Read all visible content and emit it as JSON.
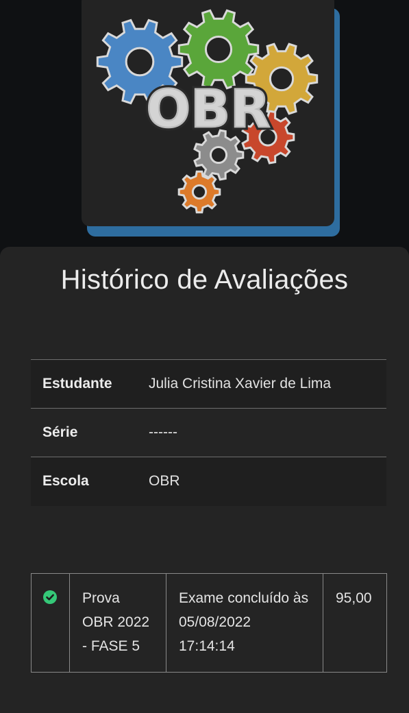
{
  "logo": {
    "text": "OBR"
  },
  "page_title": "Histórico de Avaliações",
  "student_info": [
    {
      "label": "Estudante",
      "value": "Julia Cristina Xavier de Lima"
    },
    {
      "label": "Série",
      "value": "------"
    },
    {
      "label": "Escola",
      "value": "OBR"
    }
  ],
  "exams": [
    {
      "status_icon": "check-circle-icon",
      "name": "Prova OBR 2022 - FASE 5",
      "status_text": "Exame concluído às 05/08/2022 17:14:14",
      "score": "95,00"
    }
  ],
  "colors": {
    "logo_shadow": "#2e6d9f",
    "check_green": "#35c878",
    "gear_blue": "#4a86c4",
    "gear_green": "#5aa63a",
    "gear_yellow": "#d2a73a",
    "gear_red": "#c8472c",
    "gear_gray": "#8c8c8c",
    "gear_orange": "#dc7a2a"
  }
}
